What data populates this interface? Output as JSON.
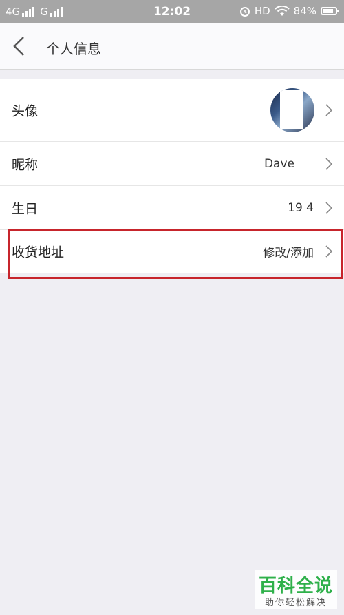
{
  "status_bar": {
    "net1": "4G",
    "net2": "G",
    "time": "12:02",
    "hd": "HD",
    "battery": "84%"
  },
  "nav": {
    "title": "个人信息"
  },
  "rows": [
    {
      "label": "头像",
      "value": ""
    },
    {
      "label": "昵称",
      "value": "Dave"
    },
    {
      "label": "生日",
      "value": "19  4"
    },
    {
      "label": "收货地址",
      "value": "修改/添加"
    }
  ],
  "watermark": {
    "title": "百科全说",
    "subtitle": "助你轻松解决"
  },
  "colors": {
    "highlight": "#c7252c",
    "watermark_green": "#2eb04a"
  }
}
